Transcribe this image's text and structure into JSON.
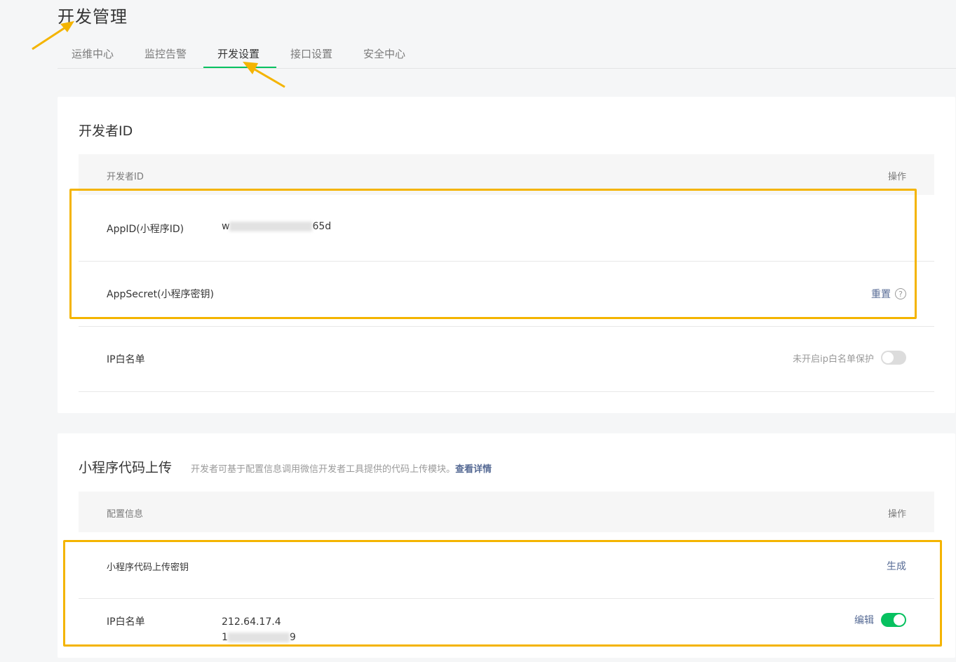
{
  "page": {
    "title": "开发管理"
  },
  "tabs": [
    {
      "label": "运维中心"
    },
    {
      "label": "监控告警"
    },
    {
      "label": "开发设置"
    },
    {
      "label": "接口设置"
    },
    {
      "label": "安全中心"
    }
  ],
  "active_tab_index": 2,
  "developer_id": {
    "title": "开发者ID",
    "header": {
      "col1": "开发者ID",
      "col2": "操作"
    },
    "rows": {
      "appid": {
        "label": "AppID(小程序ID)",
        "value_prefix": "w",
        "value_suffix": "65d"
      },
      "appsecret": {
        "label": "AppSecret(小程序密钥)",
        "action": "重置",
        "help": "?"
      },
      "ip_whitelist": {
        "label": "IP白名单",
        "status": "未开启ip白名单保护",
        "enabled": false
      }
    }
  },
  "code_upload": {
    "title": "小程序代码上传",
    "description": "开发者可基于配置信息调用微信开发者工具提供的代码上传模块。",
    "detail_link": "查看详情",
    "header": {
      "col1": "配置信息",
      "col2": "操作"
    },
    "rows": {
      "upload_key": {
        "label": "小程序代码上传密钥",
        "action": "生成"
      },
      "ip_whitelist": {
        "label": "IP白名单",
        "ip1": "212.64.17.4",
        "ip2_prefix": "1",
        "ip2_suffix": "9",
        "action": "编辑",
        "enabled": true
      }
    }
  },
  "colors": {
    "accent": "#07c160",
    "link": "#576b95",
    "highlight": "#f4b400"
  }
}
